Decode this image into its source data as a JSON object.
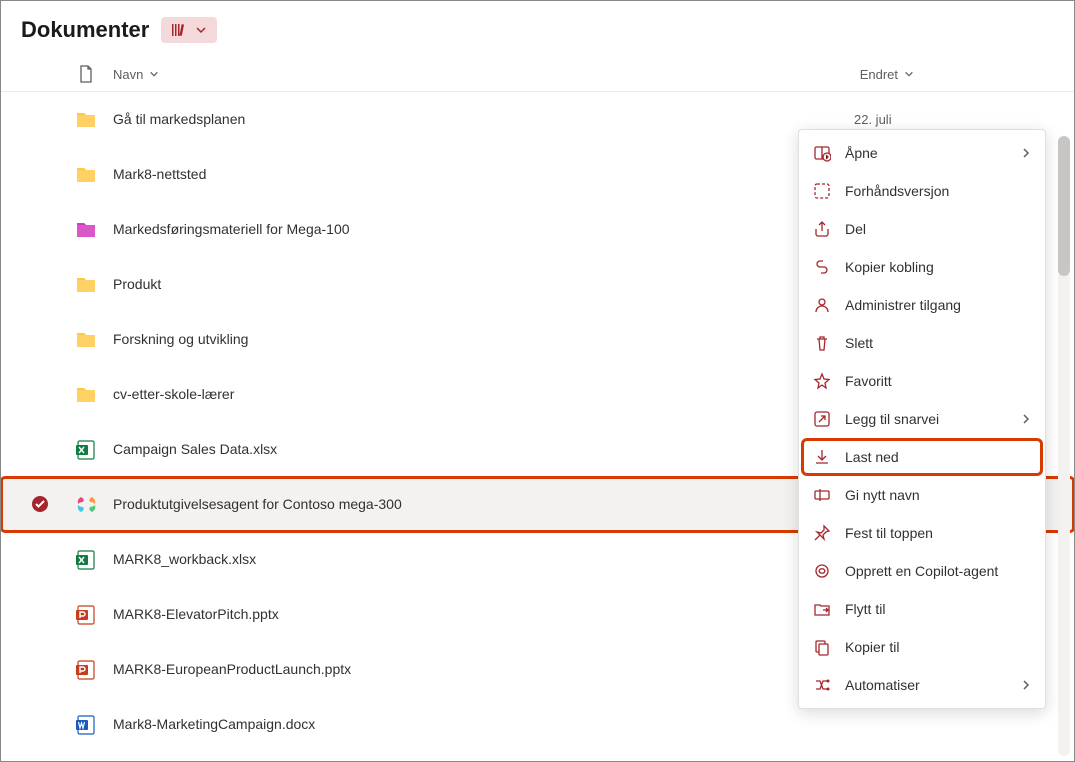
{
  "header": {
    "title": "Dokumenter"
  },
  "columns": {
    "name": "Navn",
    "modified": "Endret"
  },
  "rows": [
    {
      "icon": "folder",
      "name": "Gå til markedsplanen",
      "modified": "22. juli"
    },
    {
      "icon": "folder",
      "name": "Mark8-nettsted",
      "modified": ""
    },
    {
      "icon": "folder-pink",
      "name": "Markedsføringsmateriell for Mega-100",
      "modified": ""
    },
    {
      "icon": "folder",
      "name": "Produkt",
      "modified": ""
    },
    {
      "icon": "folder",
      "name": "Forskning og utvikling",
      "modified": ""
    },
    {
      "icon": "folder",
      "name": "cv-etter-skole-lærer",
      "modified": ""
    },
    {
      "icon": "excel",
      "name": "Campaign Sales Data.xlsx",
      "modified": ""
    },
    {
      "icon": "copilot",
      "name": "Produktutgivelsesagent for Contoso mega-300",
      "modified": "",
      "selected": true
    },
    {
      "icon": "excel",
      "name": "MARK8_workback.xlsx",
      "modified": ""
    },
    {
      "icon": "ppt",
      "name": "MARK8-ElevatorPitch.pptx",
      "modified": ""
    },
    {
      "icon": "ppt",
      "name": "MARK8-EuropeanProductLaunch.pptx",
      "modified": ""
    },
    {
      "icon": "word",
      "name": "Mark8-MarketingCampaign.docx",
      "modified": ""
    }
  ],
  "contextMenu": {
    "items": [
      {
        "icon": "open",
        "label": "Åpne",
        "submenu": true
      },
      {
        "icon": "preview",
        "label": "Forhåndsversjon"
      },
      {
        "icon": "share",
        "label": "Del"
      },
      {
        "icon": "link",
        "label": "Kopier kobling"
      },
      {
        "icon": "access",
        "label": "Administrer tilgang"
      },
      {
        "icon": "trash",
        "label": "Slett"
      },
      {
        "icon": "star",
        "label": "Favoritt"
      },
      {
        "icon": "shortcut",
        "label": "Legg til snarvei",
        "submenu": true
      },
      {
        "icon": "download",
        "label": "Last ned",
        "highlight": true
      },
      {
        "icon": "rename",
        "label": "Gi nytt navn"
      },
      {
        "icon": "pin",
        "label": "Fest til toppen"
      },
      {
        "icon": "copilot-new",
        "label": "Opprett en Copilot-agent"
      },
      {
        "icon": "move",
        "label": "Flytt til"
      },
      {
        "icon": "copy",
        "label": "Kopier til"
      },
      {
        "icon": "flow",
        "label": "Automatiser",
        "submenu": true
      }
    ]
  }
}
